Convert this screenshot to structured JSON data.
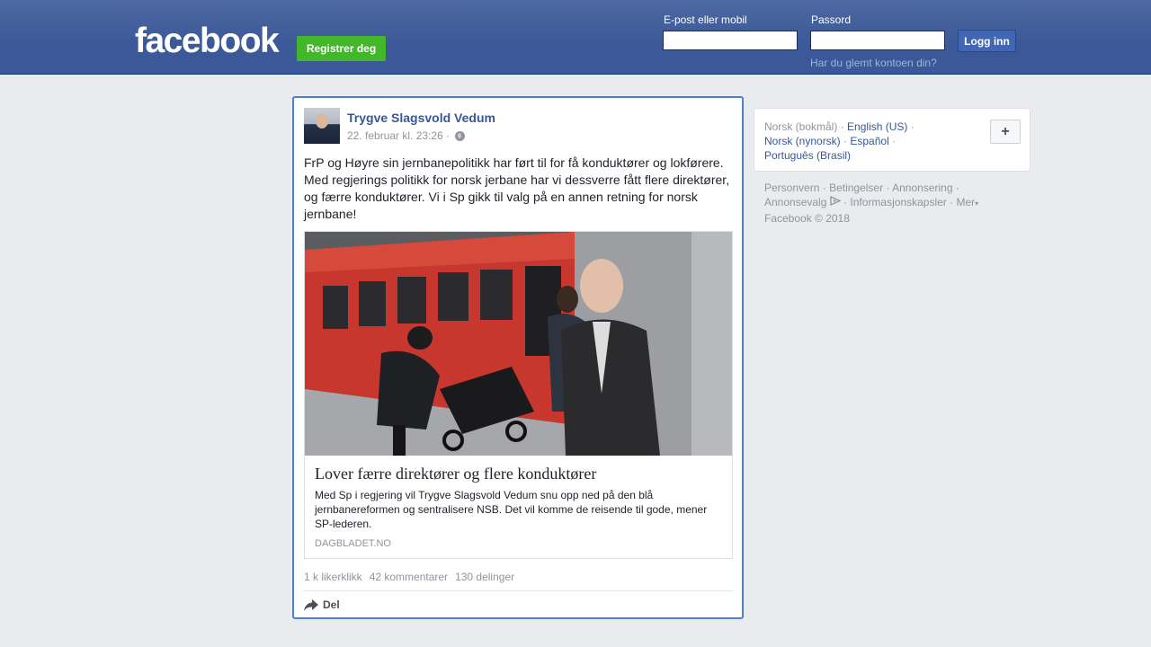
{
  "header": {
    "logo": "facebook",
    "register_label": "Registrer deg",
    "email_label": "E-post eller mobil",
    "password_label": "Passord",
    "email_value": "",
    "password_value": "",
    "login_label": "Logg inn",
    "forgot_label": "Har du glemt kontoen din?"
  },
  "post": {
    "author": "Trygve Slagsvold Vedum",
    "timestamp": "22. februar kl. 23:26",
    "separator": "·",
    "privacy_icon": "globe-icon",
    "text": "FrP og Høyre sin jernbanepolitikk har ført til for få konduktører og lokførere. Med regjerings politikk for norsk jerbane har vi dessverre fått flere direktører, og færre konduktører. Vi i Sp gikk til valg på en annen retning for norsk jernbane!",
    "link": {
      "title": "Lover færre direktører og flere konduktører",
      "description": "Med Sp i regjering vil Trygve Slagsvold Vedum snu opp ned på den blå jernbanereformen og sentralisere NSB. Det vil komme de reisende til gode, mener SP-lederen.",
      "domain": "DAGBLADET.NO"
    },
    "stats": {
      "likes": "1 k likerklikk",
      "comments": "42 kommentarer",
      "shares": "130 delinger"
    },
    "share_label": "Del"
  },
  "sidebar": {
    "languages": {
      "current": "Norsk (bokmål)",
      "english": "English (US)",
      "nynorsk": "Norsk (nynorsk)",
      "spanish": "Español",
      "portuguese": "Português (Brasil)",
      "sep": "·"
    },
    "add_language": "+",
    "footer": {
      "privacy": "Personvern",
      "terms": "Betingelser",
      "advertising": "Annonsering",
      "adchoices": "Annonsevalg",
      "cookies": "Informasjonskapsler",
      "more": "Mer",
      "copyright": "Facebook © 2018"
    }
  },
  "colors": {
    "brand": "#3b5998",
    "register_green": "#42b72a",
    "link_blue": "#365899",
    "focus_border": "#4a80d8"
  }
}
